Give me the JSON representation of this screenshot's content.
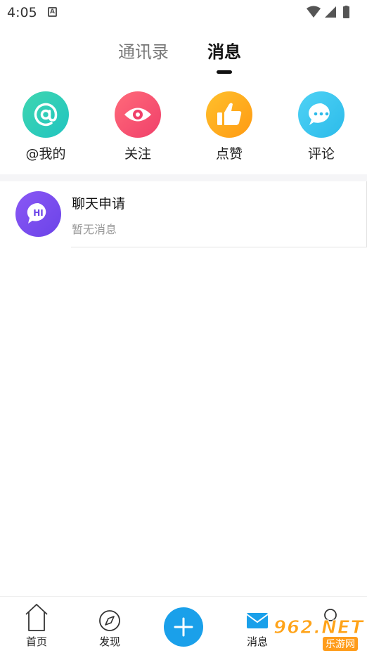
{
  "status_bar": {
    "time": "4:05",
    "notification_icon_letter": "A"
  },
  "tabs": [
    {
      "label": "通讯录",
      "active": false
    },
    {
      "label": "消息",
      "active": true
    }
  ],
  "quick_actions": [
    {
      "label": "@我的",
      "icon": "at-icon",
      "color": "#20c4c0"
    },
    {
      "label": "关注",
      "icon": "eye-icon",
      "color": "#f0406a"
    },
    {
      "label": "点赞",
      "icon": "thumbs-up-icon",
      "color": "#ff9a12"
    },
    {
      "label": "评论",
      "icon": "comment-icon",
      "color": "#2cbbea"
    }
  ],
  "messages": [
    {
      "title": "聊天申请",
      "subtitle": "暂无消息",
      "avatar_text": "HI",
      "avatar_color": "#7b4df0"
    }
  ],
  "bottom_nav": {
    "home": "首页",
    "discover": "发现",
    "messages": "消息",
    "accent": "#1aa0ea"
  },
  "watermark": {
    "top": "962.NET",
    "bottom": "乐游网"
  }
}
